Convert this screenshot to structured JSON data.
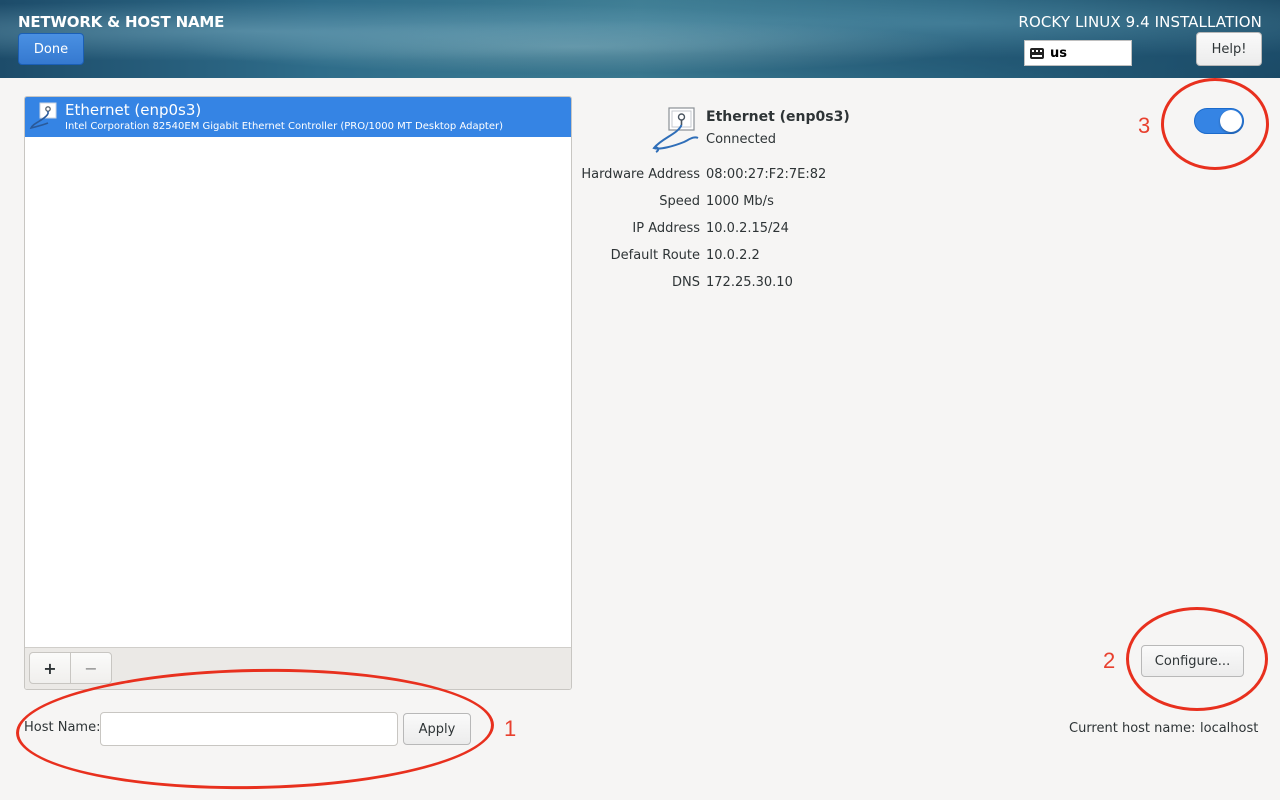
{
  "header": {
    "title": "NETWORK & HOST NAME",
    "done_label": "Done",
    "product_title": "ROCKY LINUX 9.4 INSTALLATION",
    "keyboard_layout": "us",
    "help_label": "Help!"
  },
  "devices": [
    {
      "name": "Ethernet (enp0s3)",
      "description": "Intel Corporation 82540EM Gigabit Ethernet Controller (PRO/1000 MT Desktop Adapter)",
      "selected": true
    }
  ],
  "list_toolbar": {
    "add_label": "+",
    "remove_label": "−"
  },
  "details": {
    "name": "Ethernet (enp0s3)",
    "status": "Connected",
    "enabled": true,
    "properties": [
      {
        "label": "Hardware Address",
        "value": "08:00:27:F2:7E:82"
      },
      {
        "label": "Speed",
        "value": "1000 Mb/s"
      },
      {
        "label": "IP Address",
        "value": "10.0.2.15/24"
      },
      {
        "label": "Default Route",
        "value": "10.0.2.2"
      },
      {
        "label": "DNS",
        "value": "172.25.30.10"
      }
    ],
    "configure_label": "Configure..."
  },
  "hostname": {
    "label": "Host Name:",
    "value": "",
    "placeholder": "",
    "apply_label": "Apply",
    "current_label": "Current host name:",
    "current_value": "localhost"
  },
  "annotations": [
    "1",
    "2",
    "3"
  ],
  "colors": {
    "accent": "#3584e4",
    "annotation": "#e8301e"
  }
}
